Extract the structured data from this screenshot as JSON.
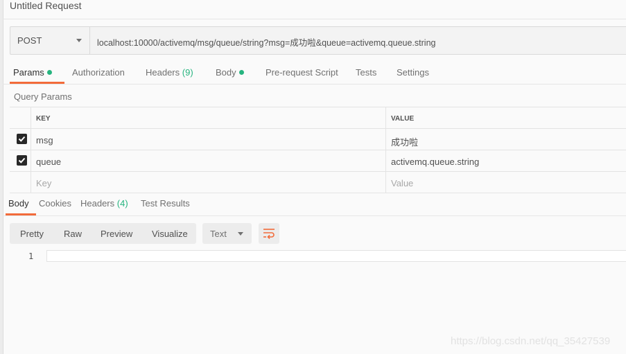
{
  "title": "Untitled Request",
  "request": {
    "method": "POST",
    "url": "localhost:10000/activemq/msg/queue/string?msg=成功啦&queue=activemq.queue.string"
  },
  "request_tabs": [
    {
      "label": "Params",
      "dot": true,
      "active": true
    },
    {
      "label": "Authorization"
    },
    {
      "label": "Headers",
      "count": "(9)"
    },
    {
      "label": "Body",
      "dot": true
    },
    {
      "label": "Pre-request Script"
    },
    {
      "label": "Tests"
    },
    {
      "label": "Settings"
    }
  ],
  "query_params": {
    "title": "Query Params",
    "columns": {
      "key": "KEY",
      "value": "VALUE"
    },
    "rows": [
      {
        "checked": true,
        "key": "msg",
        "value": "成功啦"
      },
      {
        "checked": true,
        "key": "queue",
        "value": "activemq.queue.string"
      }
    ],
    "placeholder": {
      "key": "Key",
      "value": "Value"
    }
  },
  "response_tabs": [
    {
      "label": "Body",
      "active": true
    },
    {
      "label": "Cookies"
    },
    {
      "label": "Headers",
      "count": "(4)"
    },
    {
      "label": "Test Results"
    }
  ],
  "response_toolbar": {
    "modes": [
      "Pretty",
      "Raw",
      "Preview",
      "Visualize"
    ],
    "format": "Text"
  },
  "editor": {
    "line_number": "1"
  },
  "watermark": "https://blog.csdn.net/qq_35427539",
  "colors": {
    "accent": "#f26b3a",
    "green": "#26b47f"
  }
}
